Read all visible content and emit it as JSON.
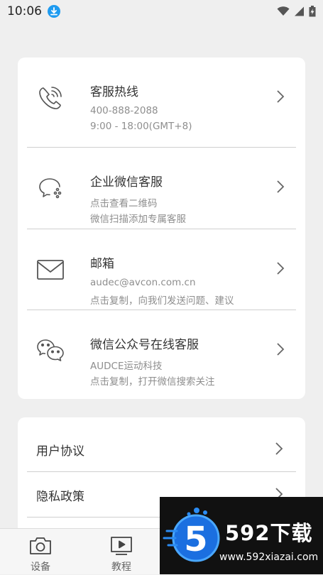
{
  "status_bar": {
    "time": "10:06",
    "download_icon": "download-icon",
    "wifi_icon": "wifi-icon",
    "signal_icon": "signal-icon",
    "battery_icon": "battery-charging-icon"
  },
  "contact": {
    "hotline": {
      "title": "客服热线",
      "line1": "400-888-2088",
      "line2": "9:00 - 18:00(GMT+8)",
      "icon": "phone-icon"
    },
    "wecom": {
      "title": "企业微信客服",
      "line1": "点击查看二维码",
      "line2": "微信扫描添加专属客服",
      "icon": "chat-bubble-icon"
    },
    "email": {
      "title": "邮箱",
      "line1": "audec@avcon.com.cn",
      "line2": "点击复制，向我们发送问题、建议",
      "icon": "mail-icon"
    },
    "wechat": {
      "title": "微信公众号在线客服",
      "line1": "AUDCE运动科技",
      "line2": "点击复制，打开微信搜索关注",
      "icon": "wechat-icon"
    }
  },
  "links": {
    "user_agreement": "用户协议",
    "privacy_policy": "隐私政策"
  },
  "tabs": [
    {
      "label": "设备",
      "icon": "camera-icon"
    },
    {
      "label": "教程",
      "icon": "play-screen-icon"
    }
  ],
  "watermark": {
    "brand": "592下载",
    "url": "www.592xiazai.com"
  },
  "colors": {
    "background": "#efefef",
    "card": "#ffffff",
    "accent": "#1e9bf0"
  }
}
